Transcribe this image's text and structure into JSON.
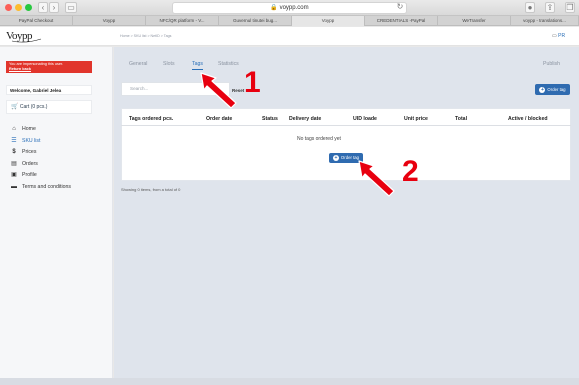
{
  "browser": {
    "url": "voypp.com",
    "tabs": [
      "PayPal Checkout",
      "Voypp",
      "NFC/QR platform - V...",
      "Guvernul tinutei bug...",
      "Voypp",
      "CREDENTIALS -PayPal",
      "WeTransfer",
      "voypp - translations..."
    ],
    "active_tab_index": 4
  },
  "app": {
    "logo": "Voypp",
    "breadcrumb": "Home > SKU list > NetID > Tags"
  },
  "sidebar": {
    "impersonate_text": "You are impersonating this user.",
    "impersonate_link": "Return back",
    "welcome": "Welcome, Gabriel Jelea",
    "cart": "Cart (0 pcs.)",
    "items": [
      {
        "label": "Home",
        "icon": "home-icon"
      },
      {
        "label": "SKU list",
        "icon": "list-icon",
        "active": true
      },
      {
        "label": "Prices",
        "icon": "dollar-icon"
      },
      {
        "label": "Orders",
        "icon": "orders-icon"
      },
      {
        "label": "Profile",
        "icon": "profile-icon"
      },
      {
        "label": "Terms and conditions",
        "icon": "terms-icon"
      }
    ]
  },
  "tabs": [
    {
      "label": "General"
    },
    {
      "label": "Slots"
    },
    {
      "label": "Tags",
      "active": true
    },
    {
      "label": "Statistics"
    }
  ],
  "publish": "Publish",
  "search": {
    "placeholder": "Search..."
  },
  "reset": "Reset",
  "order_tag": "Order tag",
  "table": {
    "columns": [
      "Tags ordered pcs.",
      "Order date",
      "Status",
      "Delivery date",
      "UID loade",
      "Unit price",
      "Total",
      "Active / blocked"
    ],
    "empty": "No tags ordered yet"
  },
  "showing": "Showing 0 items, from a total of 0",
  "annotations": {
    "first": "1",
    "second": "2"
  },
  "colors": {
    "accent": "#2f6bb0",
    "warning": "#e1352c",
    "annotation": "#e8000f"
  }
}
